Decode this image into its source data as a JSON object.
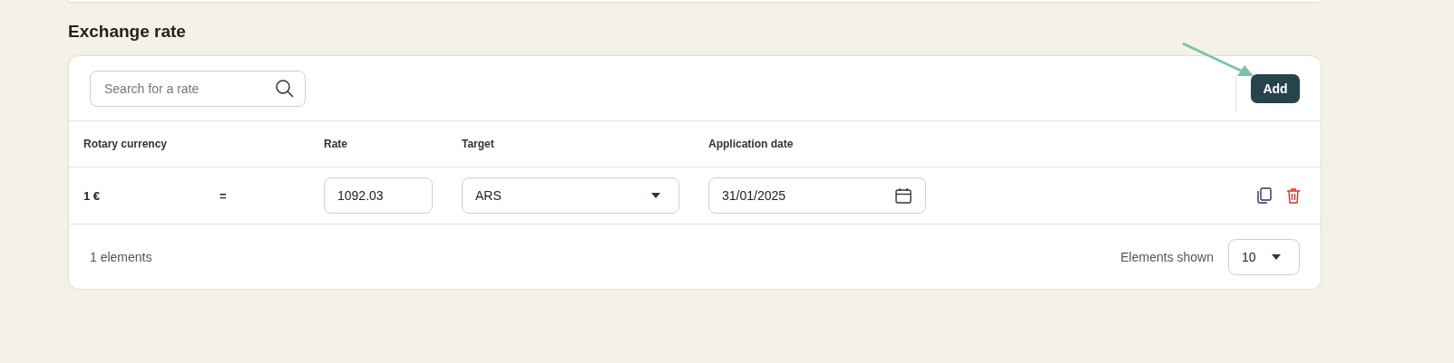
{
  "section": {
    "title": "Exchange rate"
  },
  "search": {
    "placeholder": "Search for a rate"
  },
  "add_button": {
    "label": "Add"
  },
  "table": {
    "columns": [
      "Rotary currency",
      "Rate",
      "Target",
      "Application date"
    ],
    "rows": [
      {
        "base": "1 €",
        "equals": "=",
        "rate": "1092.03",
        "target": "ARS",
        "date": "31/01/2025"
      }
    ]
  },
  "footer": {
    "count": "1 elements",
    "page_size_label": "Elements shown",
    "page_size": "10"
  }
}
